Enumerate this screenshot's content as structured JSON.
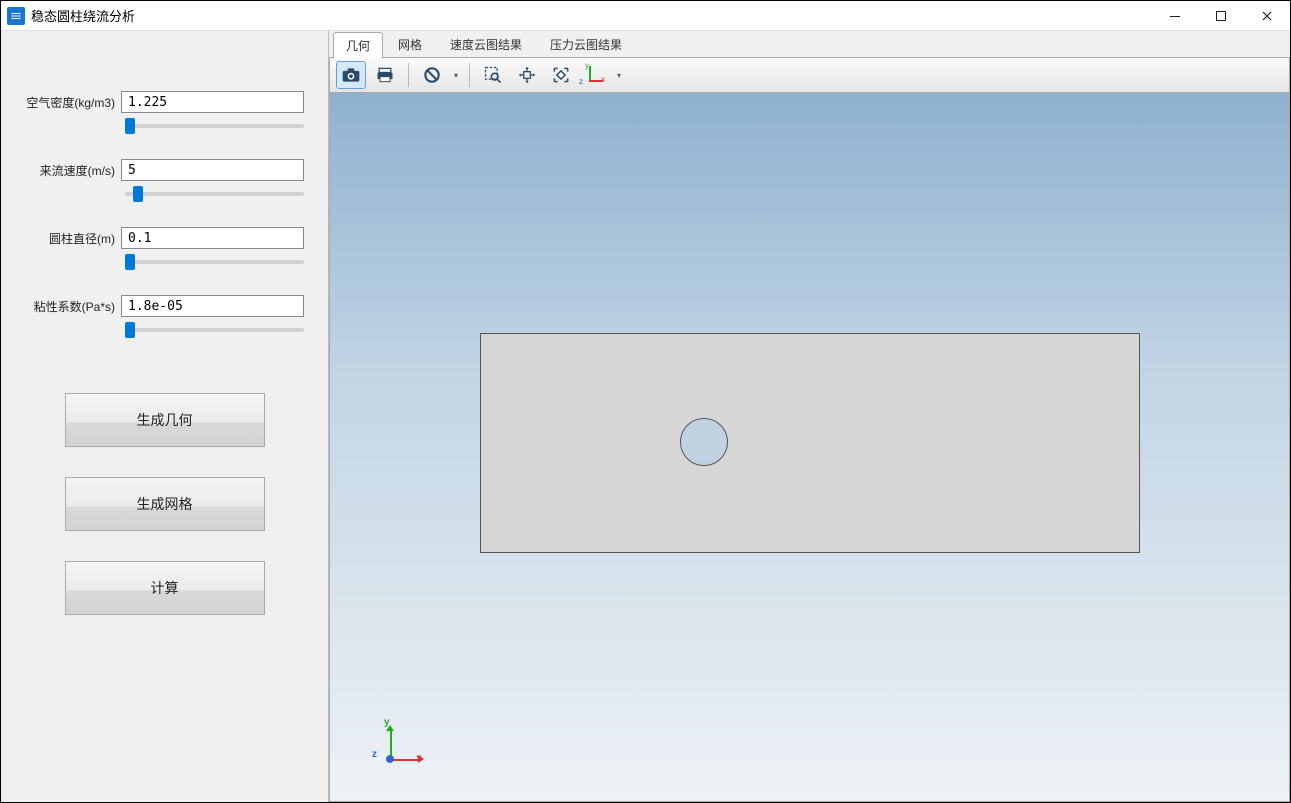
{
  "window": {
    "title": "稳态圆柱绕流分析"
  },
  "params": {
    "density": {
      "label": "空气密度(kg/m3)",
      "value": "1.225"
    },
    "velocity": {
      "label": "来流速度(m/s)",
      "value": "5"
    },
    "diameter": {
      "label": "圆柱直径(m)",
      "value": "0.1"
    },
    "viscosity": {
      "label": "粘性系数(Pa*s)",
      "value": "1.8e-05"
    }
  },
  "buttons": {
    "gen_geom": "生成几何",
    "gen_mesh": "生成网格",
    "compute": "计算"
  },
  "tabs": {
    "t0": "几何",
    "t1": "网格",
    "t2": "速度云图结果",
    "t3": "压力云图结果"
  },
  "axis": {
    "x": "x",
    "y": "y",
    "z": "z"
  }
}
